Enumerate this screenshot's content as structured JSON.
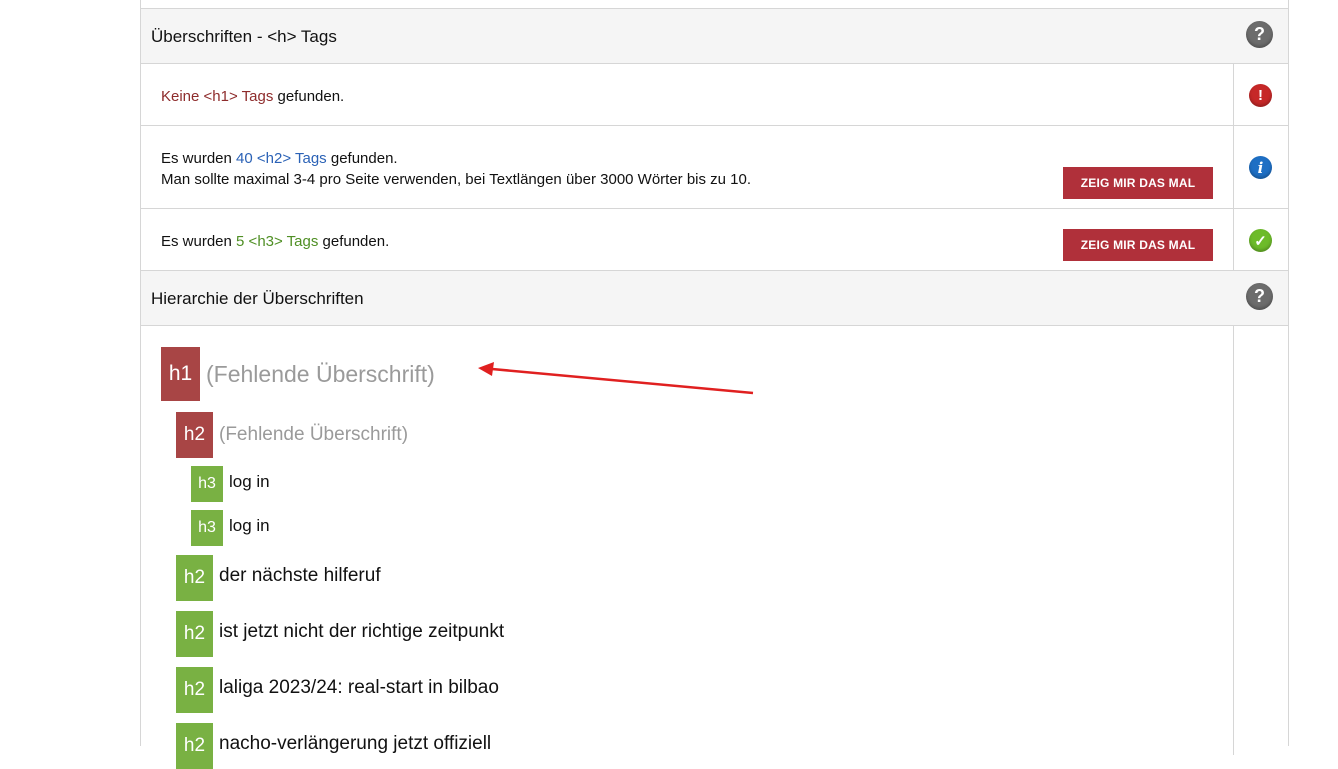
{
  "sections": {
    "headings_title": "Überschriften - <h> Tags",
    "hierarchy_title": "Hierarchie der Überschriften"
  },
  "h1_check": {
    "highlight": "Keine <h1> Tags",
    "rest": " gefunden."
  },
  "h2_check": {
    "prefix": "Es wurden ",
    "highlight": "40 <h2> Tags",
    "suffix": " gefunden.",
    "line2": "Man sollte maximal 3-4 pro Seite verwenden, bei Textlängen über 3000 Wörter bis zu 10.",
    "button": "ZEIG MIR DAS MAL"
  },
  "h3_check": {
    "prefix": "Es wurden ",
    "highlight": "5 <h3> Tags",
    "suffix": " gefunden.",
    "button": "ZEIG MIR DAS MAL"
  },
  "icons": {
    "question": "?",
    "error": "!",
    "info": "i",
    "ok": "✓"
  },
  "tree": [
    {
      "tag": "h1",
      "text": "(Fehlende Überschrift)",
      "missing": true
    },
    {
      "tag": "h2",
      "text": "(Fehlende Überschrift)",
      "missing": true
    },
    {
      "tag": "h3",
      "text": "log in",
      "missing": false
    },
    {
      "tag": "h3",
      "text": "log in",
      "missing": false
    },
    {
      "tag": "h2",
      "text": "der nächste hilferuf",
      "missing": false
    },
    {
      "tag": "h2",
      "text": "ist jetzt nicht der richtige zeitpunkt",
      "missing": false
    },
    {
      "tag": "h2",
      "text": "laliga 2023/24: real-start in bilbao",
      "missing": false
    },
    {
      "tag": "h2",
      "text": "nacho-verlängerung jetzt offiziell",
      "missing": false
    }
  ],
  "colors": {
    "missing_badge": "#a84545",
    "ok_badge": "#79b143",
    "button": "#b0303a",
    "arrow": "#e02020"
  }
}
